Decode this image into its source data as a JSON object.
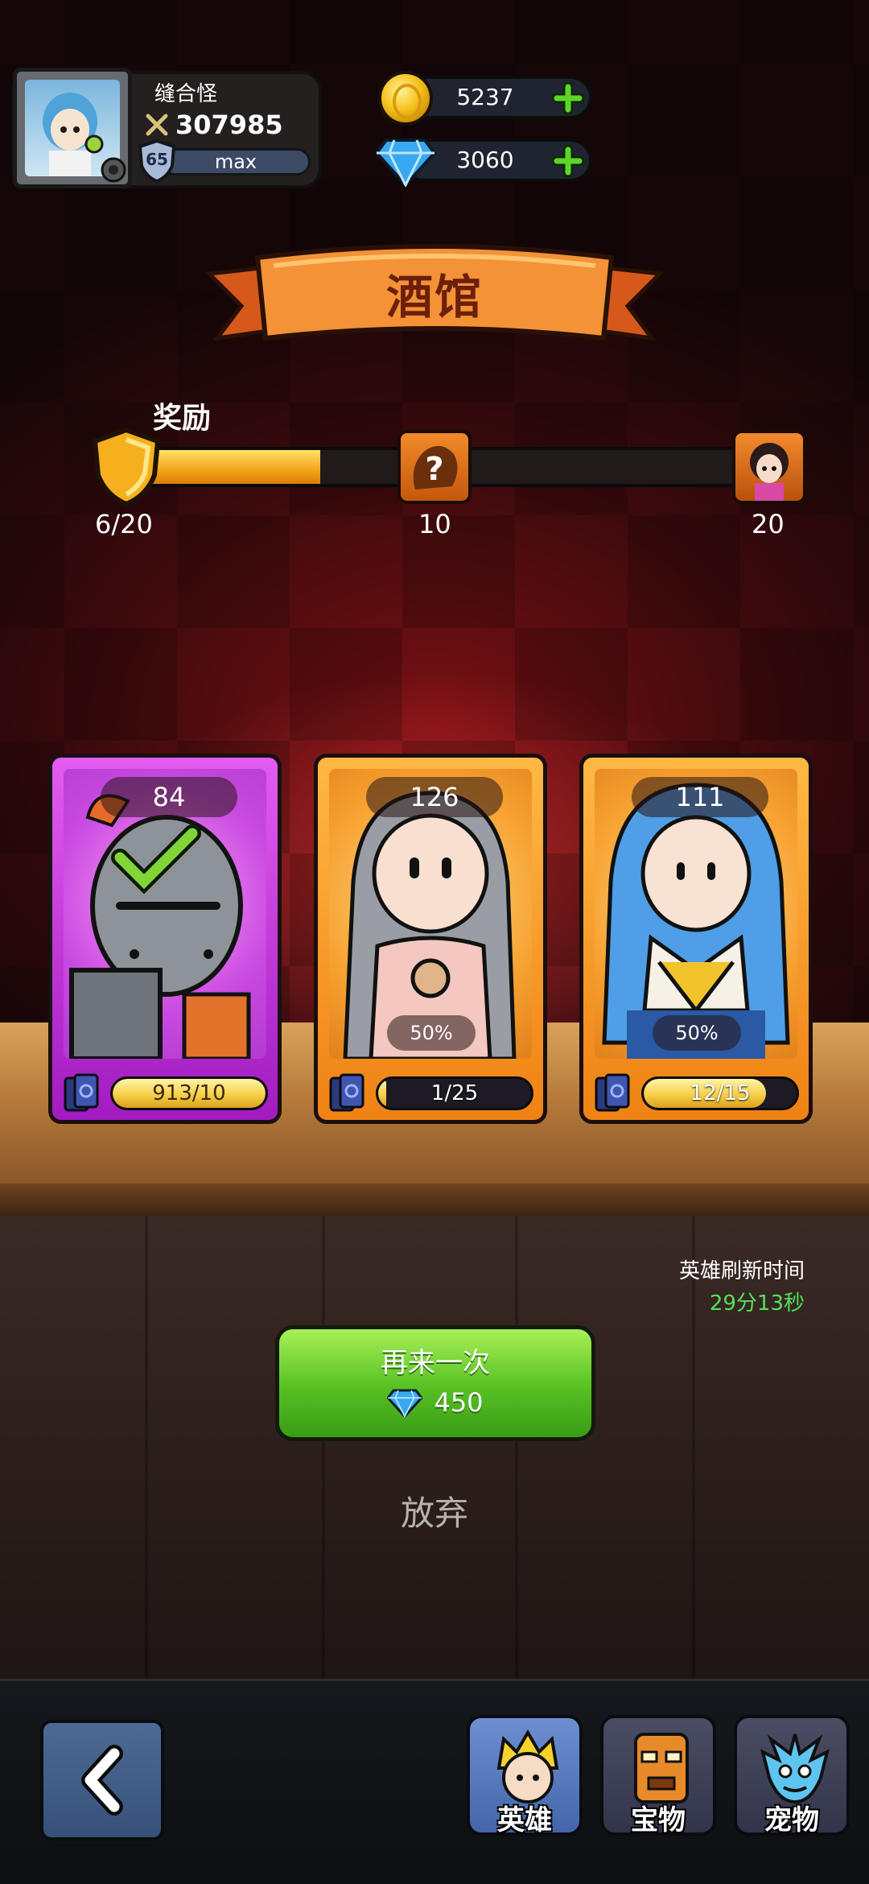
{
  "player": {
    "name": "缝合怪",
    "power": "307985",
    "level": "65",
    "level_bar_text": "max"
  },
  "currencies": {
    "gold": "5237",
    "gems": "3060"
  },
  "banner": {
    "title": "酒馆"
  },
  "reward": {
    "label": "奖励",
    "progress_text": "6/20",
    "progress_fraction": 0.3,
    "milestone_1": "10",
    "milestone_2": "20"
  },
  "cards": [
    {
      "count": "84",
      "shards": "913/10",
      "shard_fraction": 1.0,
      "rarity": "purple",
      "selected": true
    },
    {
      "count": "126",
      "chance": "50%",
      "shards": "1/25",
      "shard_fraction": 0.04,
      "rarity": "orange"
    },
    {
      "count": "111",
      "chance": "50%",
      "shards": "12/15",
      "shard_fraction": 0.8,
      "rarity": "orange"
    }
  ],
  "refresh": {
    "label": "英雄刷新时间",
    "time": "29分13秒"
  },
  "actions": {
    "again_label": "再来一次",
    "again_cost": "450",
    "give_up": "放弃"
  },
  "nav": {
    "heroes": "英雄",
    "treasure": "宝物",
    "pets": "宠物"
  },
  "colors": {
    "accent_green": "#56c022",
    "timer_green": "#53e05a",
    "ribbon_orange": "#f0812a",
    "card_purple": "#c13ce0",
    "card_orange": "#f39a22"
  }
}
